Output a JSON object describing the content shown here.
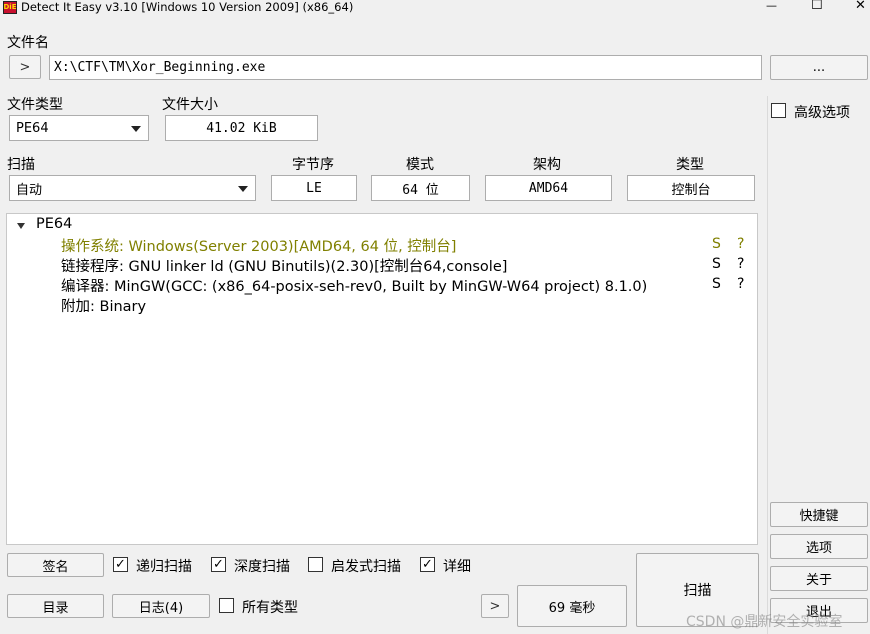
{
  "window": {
    "title": "Detect It Easy v3.10 [Windows 10 Version 2009] (x86_64)",
    "icon_text": "DiE",
    "controls": {
      "minimize": "—",
      "maximize": "☐",
      "close": "✕"
    }
  },
  "file": {
    "label": "文件名",
    "nav_glyph": ">",
    "path": "X:\\CTF\\TM\\Xor_Beginning.exe",
    "browse_label": "..."
  },
  "file_type": {
    "label": "文件类型",
    "value": "PE64"
  },
  "file_size": {
    "label": "文件大小",
    "value": "41.02 KiB"
  },
  "scan": {
    "label": "扫描",
    "value": "自动"
  },
  "endianness": {
    "label": "字节序",
    "value": "LE"
  },
  "mode": {
    "label": "模式",
    "value": "64 位"
  },
  "arch": {
    "label": "架构",
    "value": "AMD64"
  },
  "type": {
    "label": "类型",
    "value": "控制台"
  },
  "results": {
    "root": "PE64",
    "rows": [
      {
        "text": "操作系统: Windows(Server 2003)[AMD64, 64 位, 控制台]",
        "s": "S",
        "q": "?",
        "color": "#808000"
      },
      {
        "text": "链接程序: GNU linker ld (GNU Binutils)(2.30)[控制台64,console]",
        "s": "S",
        "q": "?",
        "color": "#000000"
      },
      {
        "text": "编译器: MinGW(GCC: (x86_64-posix-seh-rev0, Built by MinGW-W64 project) 8.1.0)",
        "s": "S",
        "q": "?",
        "color": "#000000"
      },
      {
        "text": "附加: Binary",
        "s": "",
        "q": "",
        "color": "#000000"
      }
    ]
  },
  "advanced": {
    "label": "高级选项",
    "checked": false
  },
  "side_buttons": {
    "shortcuts": "快捷键",
    "options": "选项",
    "about": "关于",
    "exit": "退出"
  },
  "bottom": {
    "signature_label": "签名",
    "recursive": {
      "label": "递归扫描",
      "checked": true,
      "mark": "✓"
    },
    "deep": {
      "label": "深度扫描",
      "checked": true,
      "mark": "✓"
    },
    "heuristic": {
      "label": "启发式扫描",
      "checked": false,
      "mark": ""
    },
    "verbose": {
      "label": "详细",
      "checked": true,
      "mark": "✓"
    },
    "directory_label": "目录",
    "log_label": "日志(4)",
    "all_types": {
      "label": "所有类型",
      "checked": false,
      "mark": ""
    },
    "nav_glyph": ">",
    "time_label": "69 毫秒",
    "scan_label": "扫描"
  },
  "watermark": "CSDN @鼎新安全实验室"
}
